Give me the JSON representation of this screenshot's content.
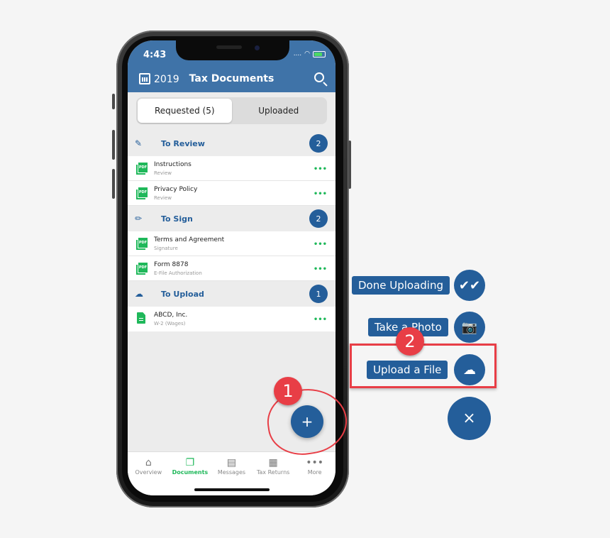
{
  "status_bar": {
    "time": "4:43",
    "signal": "....",
    "wifi_icon": "wifi-icon",
    "battery_icon": "battery-charging-icon"
  },
  "header": {
    "calendar_icon": "calendar-icon",
    "year": "2019",
    "title": "Tax Documents",
    "search_icon": "search-icon"
  },
  "segments": [
    {
      "label": "Requested (5)",
      "active": true
    },
    {
      "label": "Uploaded",
      "active": false
    }
  ],
  "sections": [
    {
      "icon": "review-icon",
      "icon_glyph": "✎",
      "title": "To Review",
      "count": "2",
      "items": [
        {
          "name": "Instructions",
          "sub": "Review",
          "icon": "pdf-icon"
        },
        {
          "name": "Privacy Policy",
          "sub": "Review",
          "icon": "pdf-icon"
        }
      ]
    },
    {
      "icon": "pencil-icon",
      "icon_glyph": "✏",
      "title": "To Sign",
      "count": "2",
      "items": [
        {
          "name": "Terms and Agreement",
          "sub": "Signature",
          "icon": "pdf-icon"
        },
        {
          "name": "Form 8878",
          "sub": "E-File Authorization",
          "icon": "pdf-icon"
        }
      ]
    },
    {
      "icon": "cloud-upload-icon",
      "icon_glyph": "☁",
      "title": "To Upload",
      "count": "1",
      "items": [
        {
          "name": "ABCD, Inc.",
          "sub": "W-2 (Wages)",
          "icon": "document-icon"
        }
      ]
    }
  ],
  "item_more": "•••",
  "fab": {
    "glyph": "+"
  },
  "tabbar": [
    {
      "label": "Overview",
      "glyph": "⌂",
      "active": false
    },
    {
      "label": "Documents",
      "glyph": "❐",
      "active": true
    },
    {
      "label": "Messages",
      "glyph": "▤",
      "active": false
    },
    {
      "label": "Tax Returns",
      "glyph": "▦",
      "active": false
    },
    {
      "label": "More",
      "glyph": "•••",
      "active": false
    }
  ],
  "actions": [
    {
      "label": "Done Uploading",
      "glyph": "✔✔",
      "icon": "double-check-icon"
    },
    {
      "label": "Take a Photo",
      "glyph": "📷",
      "icon": "camera-add-icon"
    },
    {
      "label": "Upload a File",
      "glyph": "☁",
      "icon": "cloud-upload-icon"
    }
  ],
  "close_glyph": "×",
  "annotations": {
    "step1": "1",
    "step2": "2"
  },
  "colors": {
    "header": "#3f73a8",
    "accent": "#245e9a",
    "green": "#1fb85a",
    "annotation": "#e83e46"
  }
}
